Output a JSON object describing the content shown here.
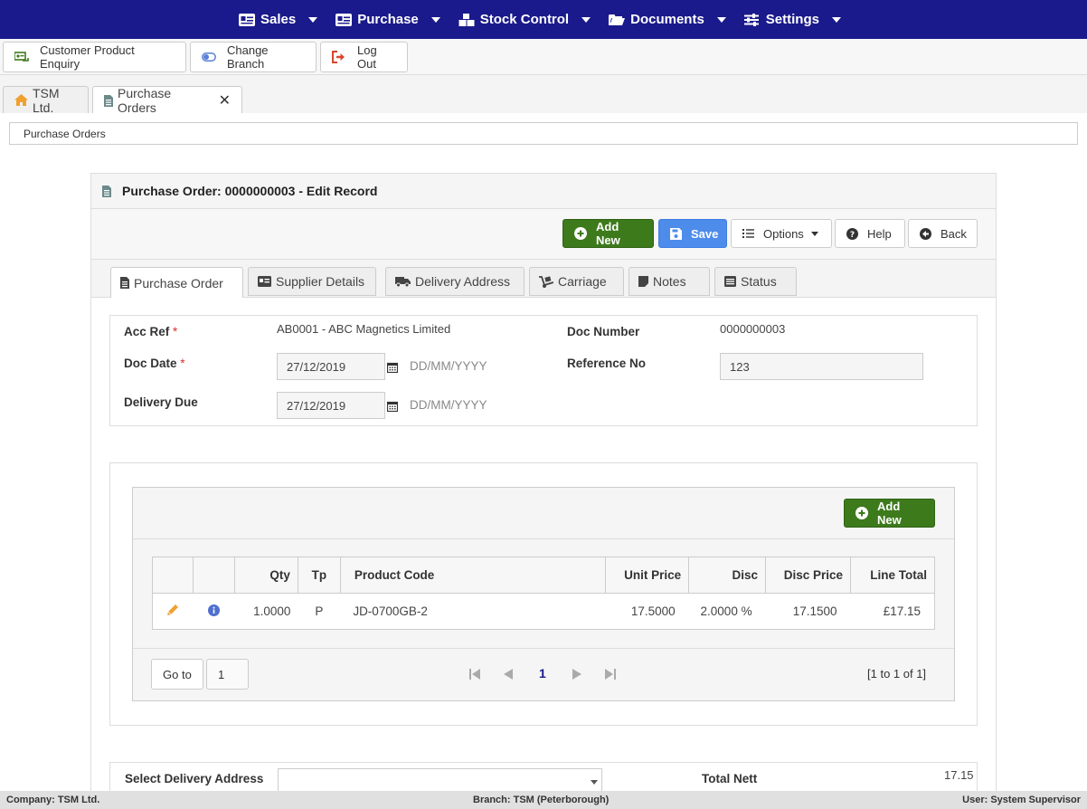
{
  "nav": {
    "items": [
      {
        "label": "Sales",
        "icon": "id-card-icon"
      },
      {
        "label": "Purchase",
        "icon": "id-badge-icon"
      },
      {
        "label": "Stock Control",
        "icon": "boxes-icon"
      },
      {
        "label": "Documents",
        "icon": "folder-icon"
      },
      {
        "label": "Settings",
        "icon": "sliders-icon"
      }
    ]
  },
  "toolbar": {
    "enquiry_label": "Customer Product Enquiry",
    "branch_label": "Change Branch",
    "logout_label": "Log Out"
  },
  "tabs": [
    {
      "label": "TSM Ltd."
    },
    {
      "label": "Purchase Orders"
    }
  ],
  "breadcrumb": "Purchase Orders",
  "panel": {
    "title": "Purchase Order: 0000000003 - Edit Record",
    "add_new": "Add New",
    "save": "Save",
    "options": "Options",
    "help": "Help",
    "back": "Back"
  },
  "form_tabs": [
    "Purchase Order",
    "Supplier Details",
    "Delivery Address",
    "Carriage",
    "Notes",
    "Status"
  ],
  "form": {
    "acc_ref_label": "Acc Ref",
    "acc_ref_value": "AB0001 - ABC Magnetics Limited",
    "doc_number_label": "Doc Number",
    "doc_number_value": "0000000003",
    "doc_date_label": "Doc Date",
    "doc_date_value": "27/12/2019",
    "date_format": "DD/MM/YYYY",
    "reference_label": "Reference No",
    "reference_value": "123",
    "delivery_due_label": "Delivery Due",
    "delivery_due_value": "27/12/2019",
    "required_mark": "*"
  },
  "grid": {
    "add_new": "Add New",
    "columns": [
      "",
      "",
      "Qty",
      "Tp",
      "Product Code",
      "Unit Price",
      "Disc",
      "Disc Price",
      "Line Total"
    ],
    "rows": [
      {
        "qty": "1.0000",
        "tp": "P",
        "product_code": "JD-0700GB-2",
        "unit_price": "17.5000",
        "disc": "2.0000 %",
        "disc_price": "17.1500",
        "line_total": "£17.15"
      }
    ],
    "goto_label": "Go to",
    "goto_value": "1",
    "current_page": "1",
    "range": "[1 to 1 of 1]"
  },
  "bottom": {
    "delivery_label": "Select Delivery Address",
    "total_nett_label": "Total Nett",
    "total_nett_value": "17.15"
  },
  "status": {
    "company": "Company: TSM Ltd.",
    "branch": "Branch: TSM (Peterborough)",
    "user": "User: System Supervisor"
  },
  "colors": {
    "nav_bg": "#1a1a8c",
    "green_button": "#3d7a1c",
    "blue_button": "#4e8cec",
    "required": "#d9302c"
  }
}
